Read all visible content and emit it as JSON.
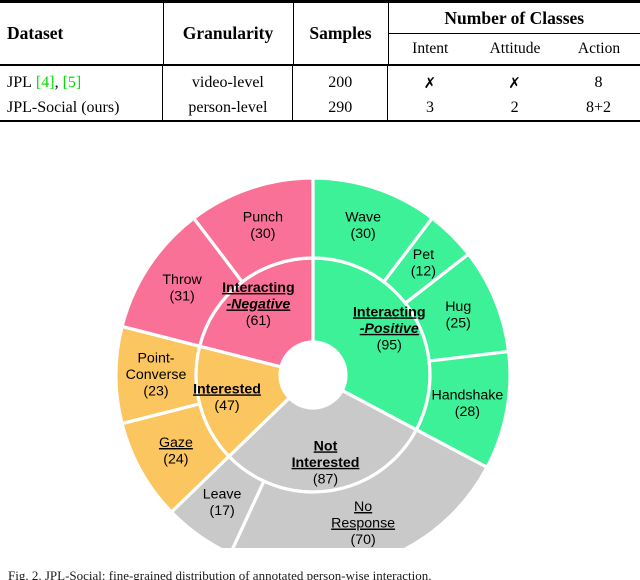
{
  "table": {
    "headers": {
      "dataset": "Dataset",
      "granularity": "Granularity",
      "samples": "Samples",
      "number_of_classes": "Number of Classes"
    },
    "subheaders": {
      "intent": "Intent",
      "attitude": "Attitude",
      "action": "Action"
    },
    "rows": [
      {
        "dataset_name": "JPL",
        "citation_1": "[4]",
        "citation_sep": ",",
        "citation_2": "[5]",
        "granularity": "video-level",
        "samples": "200",
        "intent": "✗",
        "attitude": "✗",
        "action": "8"
      },
      {
        "dataset_name": "JPL-Social (ours)",
        "citation_1": "",
        "citation_sep": "",
        "citation_2": "",
        "granularity": "person-level",
        "samples": "290",
        "intent": "3",
        "attitude": "2",
        "action": "8+2"
      }
    ],
    "citation_color": "#00e000"
  },
  "caption": {
    "text": "Fig. 2.  JPL-Social: fine-grained distribution of annotated person-wise interaction."
  },
  "chart_data": {
    "type": "pie",
    "subtype": "sunburst",
    "title": "",
    "total": 290,
    "start_angle_deg": 0,
    "direction": "clockwise",
    "colors": {
      "interacting_positive": "#3DF199",
      "interacting_negative": "#FA7197",
      "interested": "#FBC55F",
      "not_interested": "#C9C9C9",
      "separator": "#FFFFFF",
      "background": "#FFFFFF"
    },
    "inner_ring": [
      {
        "label_line1": "Interacting",
        "label_line2": "-Positive",
        "value": 95,
        "color_key": "interacting_positive",
        "color": "#3DF199"
      },
      {
        "label_line1": "Not",
        "label_line2": "Interested",
        "value": 87,
        "color_key": "not_interested",
        "color": "#C9C9C9"
      },
      {
        "label_line1": "Interested",
        "label_line2": "",
        "value": 47,
        "color_key": "interested",
        "color": "#FBC55F"
      },
      {
        "label_line1": "Interacting",
        "label_line2": "-Negative",
        "value": 61,
        "color_key": "interacting_negative",
        "color": "#FA7197"
      }
    ],
    "outer_ring": [
      {
        "label": "Wave",
        "value": 30,
        "parent": "Interacting-Positive",
        "color": "#3DF199"
      },
      {
        "label": "Pet",
        "value": 12,
        "parent": "Interacting-Positive",
        "color": "#3DF199"
      },
      {
        "label": "Hug",
        "value": 25,
        "parent": "Interacting-Positive",
        "color": "#3DF199"
      },
      {
        "label": "Handshake",
        "value": 28,
        "parent": "Interacting-Positive",
        "color": "#3DF199"
      },
      {
        "label_line1": "No",
        "label_line2": "Response",
        "label": "No Response",
        "value": 70,
        "parent": "Not Interested",
        "color": "#C9C9C9"
      },
      {
        "label": "Leave",
        "value": 17,
        "parent": "Not Interested",
        "color": "#C9C9C9"
      },
      {
        "label": "Gaze",
        "value": 24,
        "parent": "Interested",
        "color": "#FBC55F"
      },
      {
        "label_line1": "Point-",
        "label_line2": "Converse",
        "label": "Point-Converse",
        "value": 23,
        "parent": "Interested",
        "color": "#FBC55F"
      },
      {
        "label": "Throw",
        "value": 31,
        "parent": "Interacting-Negative",
        "color": "#FA7197"
      },
      {
        "label": "Punch",
        "value": 30,
        "parent": "Interacting-Negative",
        "color": "#FA7197"
      }
    ]
  }
}
